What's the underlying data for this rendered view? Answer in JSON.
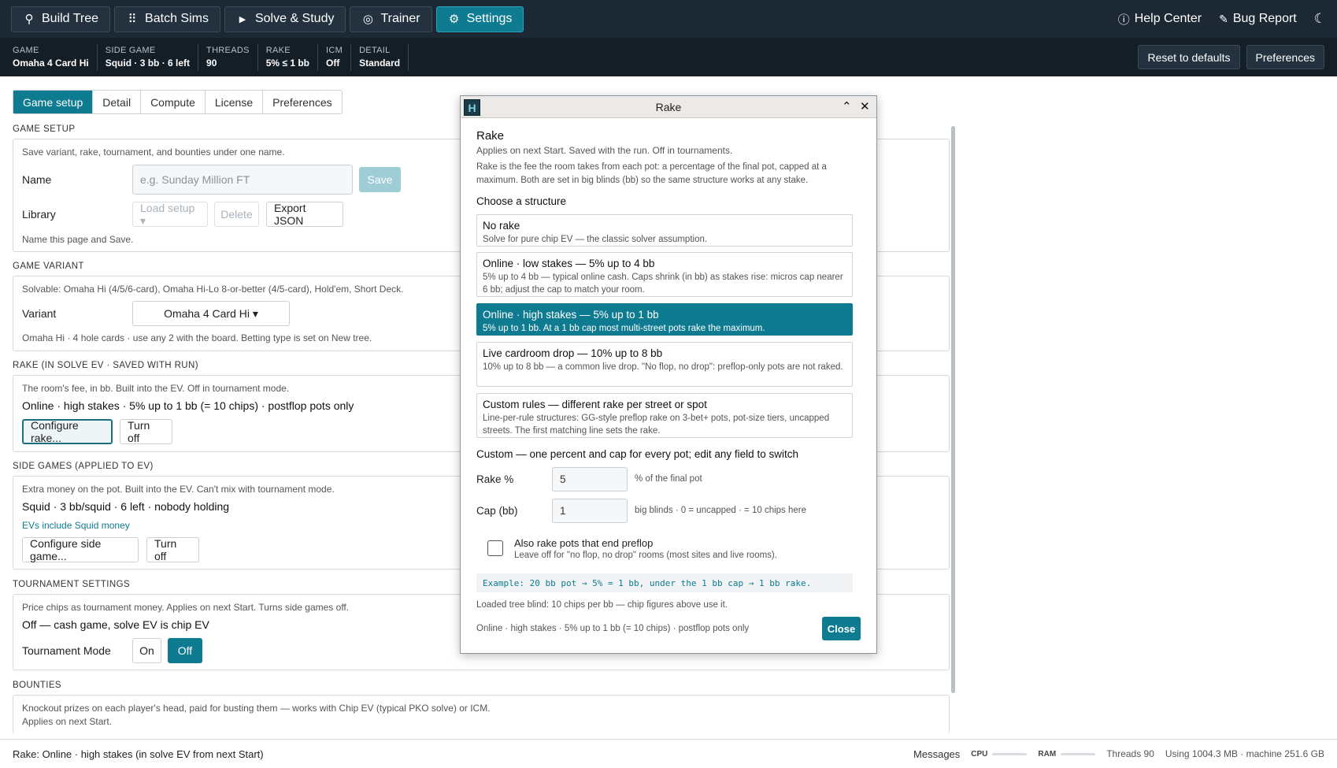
{
  "nav": {
    "buttons": [
      {
        "label": "Build Tree",
        "icon": "tree-icon"
      },
      {
        "label": "Batch Sims",
        "icon": "grid-icon"
      },
      {
        "label": "Solve & Study",
        "icon": "play-icon"
      },
      {
        "label": "Trainer",
        "icon": "target-icon"
      },
      {
        "label": "Settings",
        "icon": "gear-icon"
      }
    ],
    "help": "Help Center",
    "bug": "Bug Report"
  },
  "strip": {
    "items": [
      {
        "label": "GAME",
        "value": "Omaha 4 Card Hi"
      },
      {
        "label": "SIDE GAME",
        "value": "Squid · 3 bb · 6 left"
      },
      {
        "label": "THREADS",
        "value": "90"
      },
      {
        "label": "RAKE",
        "value": "5% ≤ 1 bb"
      },
      {
        "label": "ICM",
        "value": "Off"
      },
      {
        "label": "DETAIL",
        "value": "Standard"
      }
    ],
    "reset": "Reset to defaults",
    "preferences": "Preferences"
  },
  "tabs": [
    "Game setup",
    "Detail",
    "Compute",
    "License",
    "Preferences"
  ],
  "game_setup": {
    "title": "GAME SETUP",
    "desc": "Save variant, rake, tournament, and bounties under one name.",
    "name_label": "Name",
    "name_placeholder": "e.g. Sunday Million FT",
    "save": "Save",
    "library_label": "Library",
    "load": "Load setup ▾",
    "delete": "Delete",
    "export": "Export JSON",
    "hint": "Name this page and Save."
  },
  "variant": {
    "title": "GAME VARIANT",
    "desc": "Solvable: Omaha Hi (4/5/6-card), Omaha Hi-Lo 8-or-better (4/5-card), Hold'em, Short Deck.",
    "label": "Variant",
    "value": "Omaha 4 Card Hi ▾",
    "hint": "Omaha Hi · 4 hole cards · use any 2 with the board. Betting type is set on New tree."
  },
  "rake": {
    "title": "RAKE (IN SOLVE EV · SAVED WITH RUN)",
    "desc": "The room's fee, in bb. Built into the EV. Off in tournament mode.",
    "current": "Online · high stakes · 5% up to 1 bb (= 10 chips) · postflop pots only",
    "configure": "Configure rake...",
    "turnoff": "Turn off"
  },
  "side": {
    "title": "SIDE GAMES (APPLIED TO EV)",
    "desc": "Extra money on the pot. Built into the EV. Can't mix with tournament mode.",
    "current": "Squid · 3 bb/squid · 6 left · nobody holding",
    "link": "EVs include Squid money",
    "configure": "Configure side game...",
    "turnoff": "Turn off"
  },
  "tournament": {
    "title": "TOURNAMENT SETTINGS",
    "desc": "Price chips as tournament money. Applies on next Start. Turns side games off.",
    "current": "Off — cash game, solve EV is chip EV",
    "label": "Tournament Mode",
    "on": "On",
    "off": "Off"
  },
  "bounties": {
    "title": "BOUNTIES",
    "desc1": "Knockout prizes on each player's head, paid for busting them — works with Chip EV (typical PKO solve) or ICM.",
    "desc2": "Applies on next Start."
  },
  "bottom": {
    "status": "Rake: Online · high stakes (in solve EV from next Start)",
    "messages": "Messages",
    "cpu": "CPU",
    "ram": "RAM",
    "threads": "Threads 90",
    "memory": "Using 1004.3 MB · machine 251.6 GB"
  },
  "modal": {
    "logo": "H",
    "window_title": "Rake",
    "heading": "Rake",
    "sub": "Applies on next Start. Saved with the run. Off in tournaments.",
    "desc": "Rake is the fee the room takes from each pot: a percentage of the final pot, capped at a maximum. Both are set in big blinds (bb) so the same structure works at any stake.",
    "choose": "Choose a structure",
    "options": [
      {
        "title": "No rake",
        "desc": "Solve for pure chip EV — the classic solver assumption."
      },
      {
        "title": "Online · low stakes — 5% up to 4 bb",
        "desc": "5% up to 4 bb — typical online cash. Caps shrink (in bb) as stakes rise: micros cap nearer 6 bb; adjust the cap to match your room."
      },
      {
        "title": "Online · high stakes — 5% up to 1 bb",
        "desc": "5% up to 1 bb. At a 1 bb cap most multi-street pots rake the maximum."
      },
      {
        "title": "Live cardroom drop — 10% up to 8 bb",
        "desc": "10% up to 8 bb — a common live drop. \"No flop, no drop\": preflop-only pots are not raked."
      },
      {
        "title": "Custom rules — different rake per street or spot",
        "desc": "Line-per-rule structures: GG-style preflop rake on 3-bet+ pots, pot-size tiers, uncapped streets. The first matching line sets the rake."
      }
    ],
    "custom_heading": "Custom — one percent and cap for every pot; edit any field to switch",
    "rake_label": "Rake %",
    "rake_value": "5",
    "rake_unit": "% of the final pot",
    "cap_label": "Cap (bb)",
    "cap_value": "1",
    "cap_unit": "big blinds · 0 = uncapped · = 10 chips here",
    "preflop_title": "Also rake pots that end preflop",
    "preflop_desc": "Leave off for \"no flop, no drop\" rooms (most sites and live rooms).",
    "example": "Example: 20 bb pot → 5% = 1 bb, under the 1 bb cap → 1 bb rake.",
    "loaded": "Loaded tree blind: 10 chips per bb — chip figures above use it.",
    "summary": "Online · high stakes · 5% up to 1 bb (= 10 chips) · postflop pots only",
    "close": "Close"
  }
}
